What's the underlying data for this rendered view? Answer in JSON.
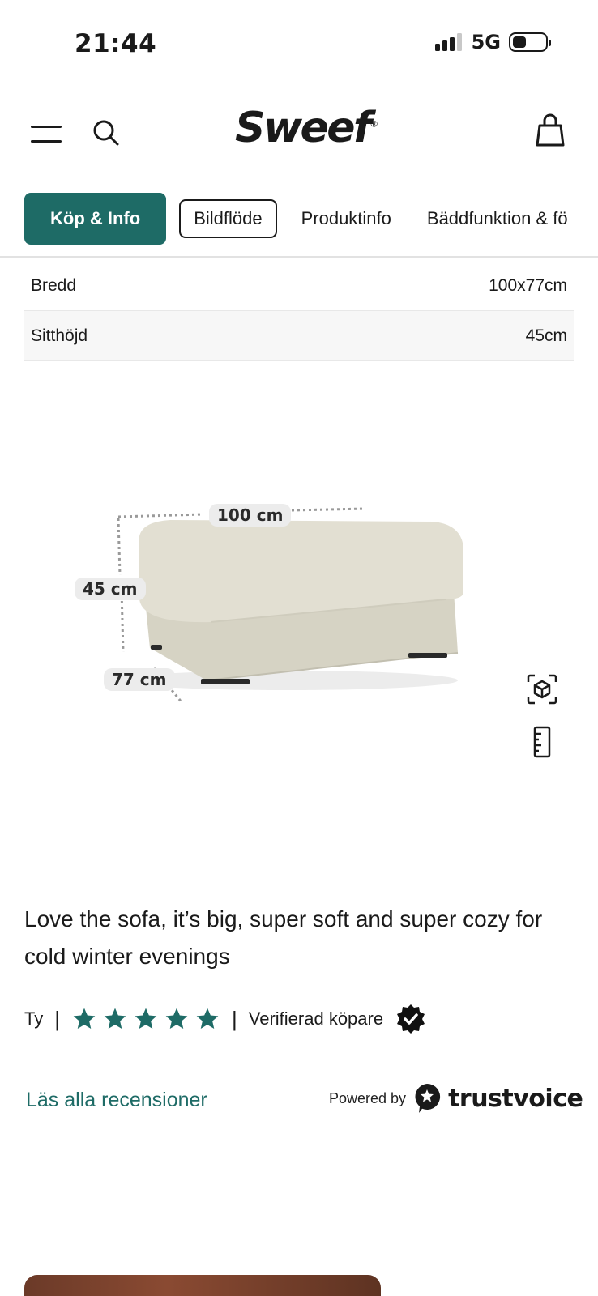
{
  "status_bar": {
    "time": "21:44",
    "network": "5G"
  },
  "header": {
    "logo": "Sweef",
    "logo_mark": "®"
  },
  "tabs": [
    {
      "label": "Köp & Info"
    },
    {
      "label": "Bildflöde"
    },
    {
      "label": "Produktinfo"
    },
    {
      "label": "Bäddfunktion & fö"
    }
  ],
  "specs": [
    {
      "label": "Bredd",
      "value": "100x77cm"
    },
    {
      "label": "Sitthöjd",
      "value": "45cm"
    }
  ],
  "dimensions": {
    "width": "100 cm",
    "height": "45 cm",
    "depth": "77 cm"
  },
  "review": {
    "text": "Love the sofa, it’s big, super soft and super cozy for cold winter evenings",
    "author": "Ty",
    "rating": 5,
    "rating_max": 5,
    "verified_label": "Verifierad köpare",
    "read_all": "Läs alla recensioner",
    "powered_by": "Powered by",
    "provider": "trustvoice"
  },
  "colors": {
    "accent": "#1e6b66",
    "text": "#1a1a1a"
  }
}
